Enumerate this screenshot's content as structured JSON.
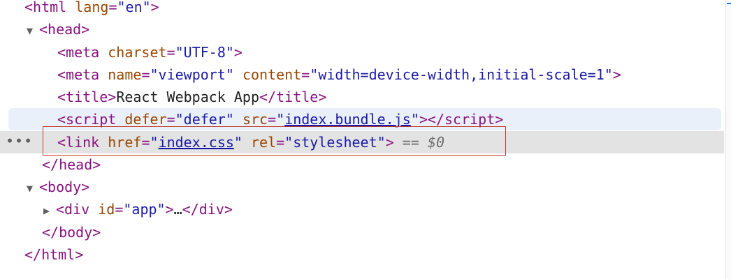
{
  "elements_tree": {
    "html_open": {
      "tag": "html",
      "attr_name": "lang",
      "attr_value": "en"
    },
    "head_open": {
      "tag": "head"
    },
    "meta_charset": {
      "tag": "meta",
      "attr_name": "charset",
      "attr_value": "UTF-8"
    },
    "meta_viewport": {
      "tag": "meta",
      "attr1_name": "name",
      "attr1_value": "viewport",
      "attr2_name": "content",
      "attr2_value": "width=device-width,initial-scale=1"
    },
    "title": {
      "tag": "title",
      "text": "React Webpack App"
    },
    "script": {
      "tag": "script",
      "attr1_name": "defer",
      "attr1_value": "defer",
      "attr2_name": "src",
      "attr2_value": "index.bundle.js"
    },
    "link": {
      "tag": "link",
      "attr1_name": "href",
      "attr1_value": "index.css",
      "attr2_name": "rel",
      "attr2_value": "stylesheet",
      "suffix_eq": "==",
      "suffix_var": "$0"
    },
    "head_close": {
      "tag": "head"
    },
    "body_open": {
      "tag": "body"
    },
    "div": {
      "tag": "div",
      "attr_name": "id",
      "attr_value": "app",
      "ellipsis": "…"
    },
    "body_close": {
      "tag": "body"
    },
    "html_close": {
      "tag": "html"
    },
    "more_actions": "•••"
  },
  "colors": {
    "tag": "#881280",
    "attribute_name": "#994500",
    "attribute_value": "#1a1aa6",
    "selected_row": "#e3e3e3",
    "hover_row": "#eaf0fa",
    "highlight_box": "#c0392b"
  }
}
